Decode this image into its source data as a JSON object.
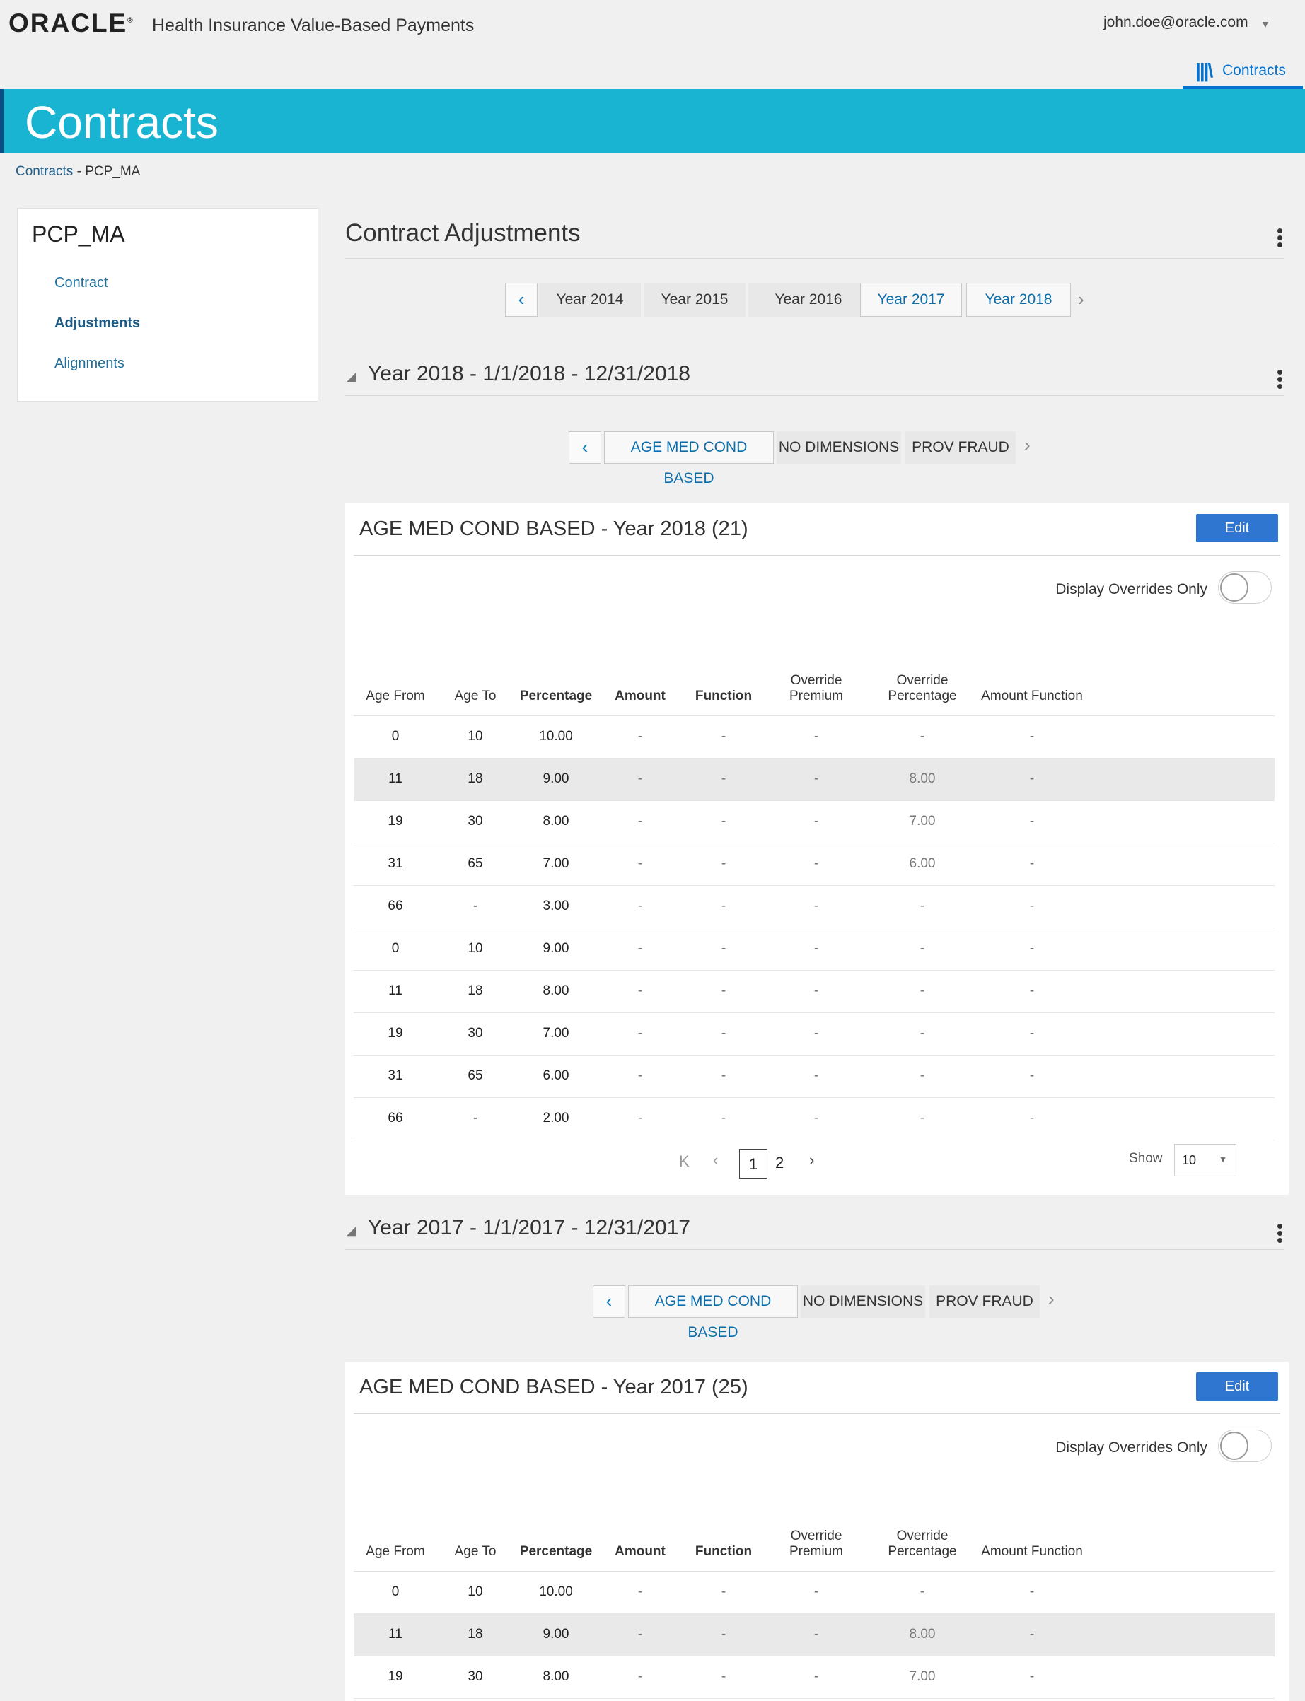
{
  "header": {
    "logo": "ORACLE",
    "logo_mark": "®",
    "app_name": "Health Insurance Value-Based Payments",
    "user": "john.doe@oracle.com",
    "nav_tab": "Contracts"
  },
  "banner": {
    "title": "Contracts"
  },
  "breadcrumb": {
    "root": "Contracts",
    "sep": " - ",
    "current": "PCP_MA"
  },
  "sidebar": {
    "title": "PCP_MA",
    "items": [
      {
        "label": "Contract",
        "active": false
      },
      {
        "label": "Adjustments",
        "active": true
      },
      {
        "label": "Alignments",
        "active": false
      }
    ]
  },
  "main": {
    "title": "Contract Adjustments",
    "years": [
      "Year 2014",
      "Year 2015",
      "Year 2016",
      "Year 2017",
      "Year 2018"
    ],
    "selected_years": [
      "Year 2017",
      "Year 2018"
    ]
  },
  "sections": [
    {
      "heading": "Year 2018 - 1/1/2018 - 12/31/2018",
      "tabs": [
        "AGE MED COND BASED",
        "NO DIMENSIONS",
        "PROV FRAUD"
      ],
      "selected_tab": "AGE MED COND BASED",
      "card_title": "AGE MED COND BASED - Year 2018 (21)",
      "edit_label": "Edit",
      "toggle_label": "Display Overrides Only",
      "columns": [
        "Age From",
        "Age To",
        "Percentage",
        "Amount",
        "Function",
        "Override Premium",
        "Override Percentage",
        "Amount Function"
      ],
      "rows": [
        [
          "0",
          "10",
          "10.00",
          "-",
          "-",
          "-",
          "-",
          "-"
        ],
        [
          "11",
          "18",
          "9.00",
          "-",
          "-",
          "-",
          "8.00",
          "-"
        ],
        [
          "19",
          "30",
          "8.00",
          "-",
          "-",
          "-",
          "7.00",
          "-"
        ],
        [
          "31",
          "65",
          "7.00",
          "-",
          "-",
          "-",
          "6.00",
          "-"
        ],
        [
          "66",
          "-",
          "3.00",
          "-",
          "-",
          "-",
          "-",
          "-"
        ],
        [
          "0",
          "10",
          "9.00",
          "-",
          "-",
          "-",
          "-",
          "-"
        ],
        [
          "11",
          "18",
          "8.00",
          "-",
          "-",
          "-",
          "-",
          "-"
        ],
        [
          "19",
          "30",
          "7.00",
          "-",
          "-",
          "-",
          "-",
          "-"
        ],
        [
          "31",
          "65",
          "6.00",
          "-",
          "-",
          "-",
          "-",
          "-"
        ],
        [
          "66",
          "-",
          "2.00",
          "-",
          "-",
          "-",
          "-",
          "-"
        ]
      ],
      "pager": {
        "first": "K",
        "prev": "‹",
        "pages": [
          "1",
          "2"
        ],
        "current": "1",
        "next": "›",
        "show_label": "Show",
        "page_size": "10"
      }
    },
    {
      "heading": "Year 2017 - 1/1/2017 - 12/31/2017",
      "tabs": [
        "AGE MED COND BASED",
        "NO DIMENSIONS",
        "PROV FRAUD"
      ],
      "selected_tab": "AGE MED COND BASED",
      "card_title": "AGE MED COND BASED - Year 2017 (25)",
      "edit_label": "Edit",
      "toggle_label": "Display Overrides Only",
      "columns": [
        "Age From",
        "Age To",
        "Percentage",
        "Amount",
        "Function",
        "Override Premium",
        "Override Percentage",
        "Amount Function"
      ],
      "rows": [
        [
          "0",
          "10",
          "10.00",
          "-",
          "-",
          "-",
          "-",
          "-"
        ],
        [
          "11",
          "18",
          "9.00",
          "-",
          "-",
          "-",
          "8.00",
          "-"
        ],
        [
          "19",
          "30",
          "8.00",
          "-",
          "-",
          "-",
          "7.00",
          "-"
        ]
      ]
    }
  ],
  "icons": {
    "user_menu": "caret-down-icon",
    "nav_tab": "books-icon",
    "more": "kebab-menu-icon",
    "collapse": "triangle-collapse-icon",
    "prev": "chevron-left-icon",
    "next": "chevron-right-icon"
  },
  "colors": {
    "banner": "#19b4d2",
    "accent": "#0572ce",
    "edit_button": "#2e76cf",
    "link": "#1f6f9b"
  }
}
